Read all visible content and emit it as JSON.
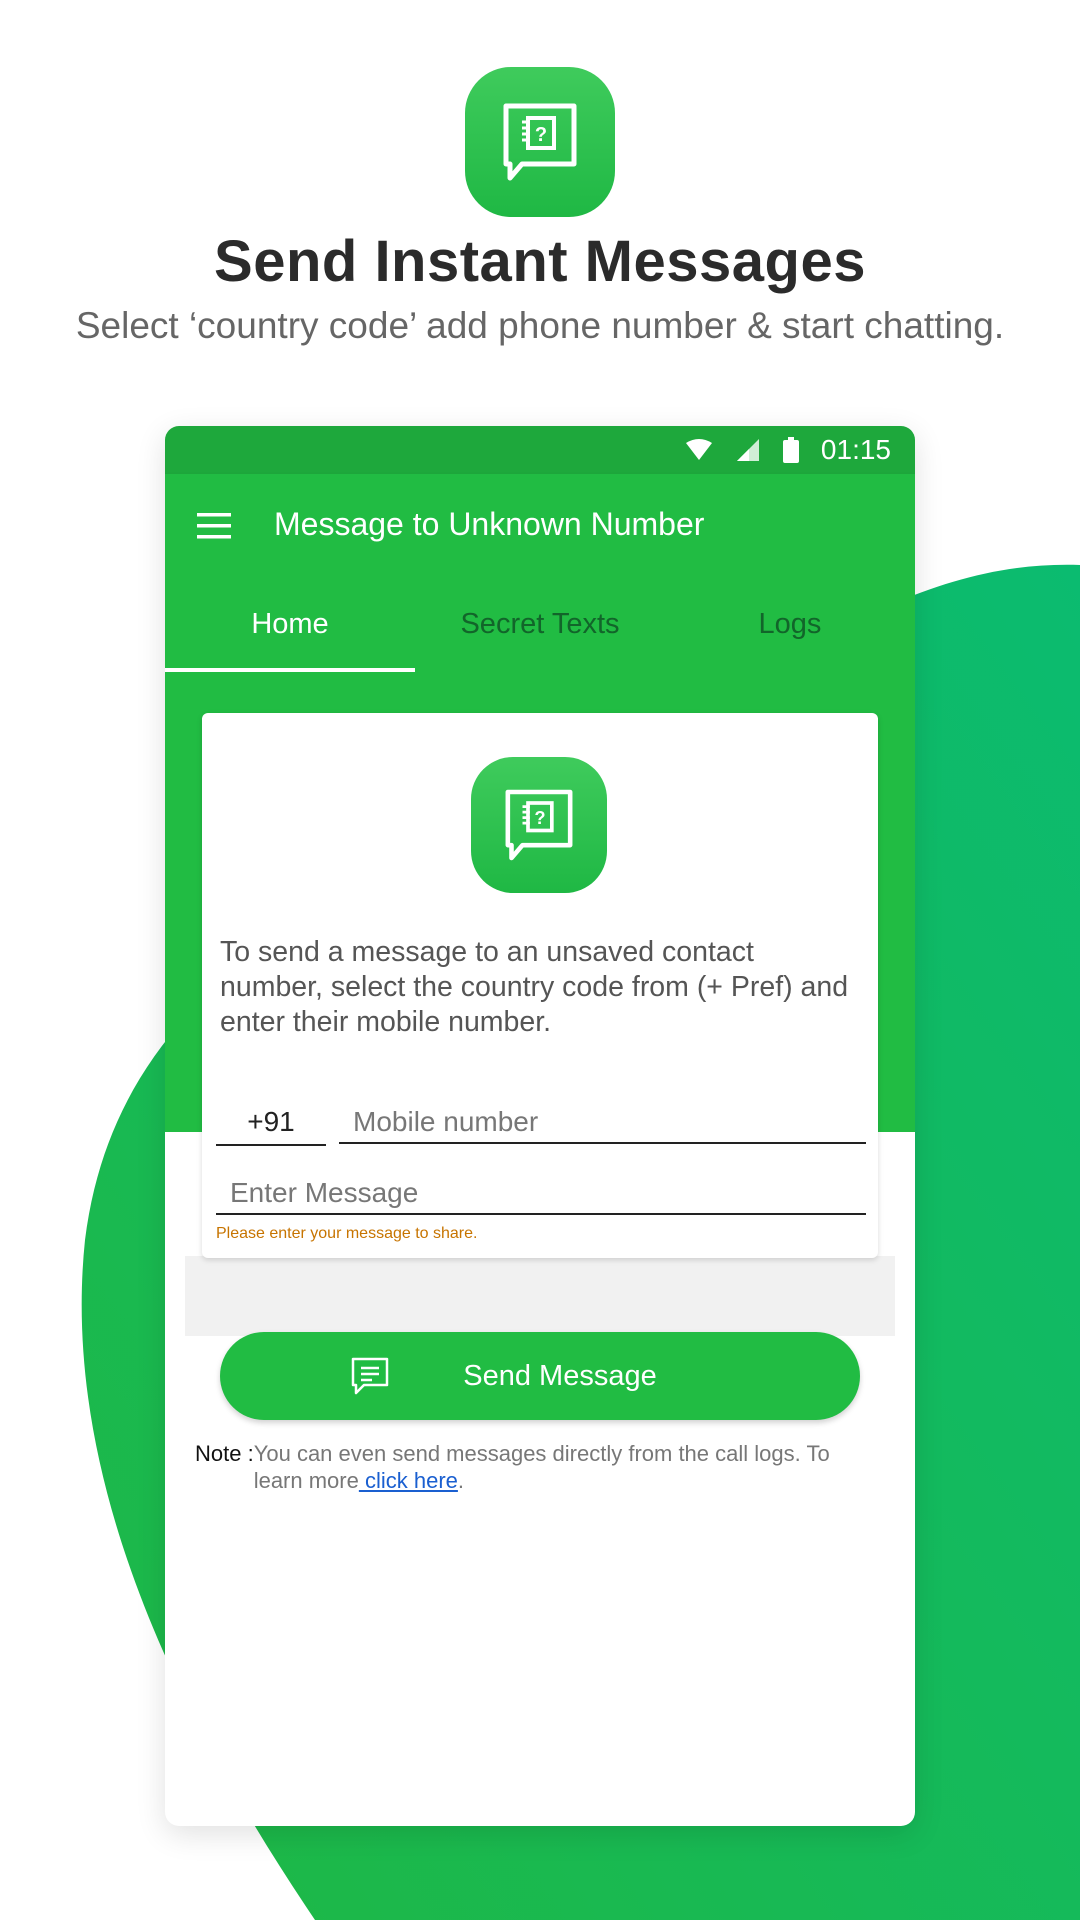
{
  "colors": {
    "brand_green": "#21bc43",
    "status_green": "#1ea83c",
    "link_blue": "#1a5fd0",
    "error_orange": "#c77400"
  },
  "promo": {
    "title": "Send Instant Messages",
    "subtitle": "Select ‘country code’ add phone number & start chatting.",
    "icon": "chat-question-icon"
  },
  "statusbar": {
    "time": "01:15",
    "icons": [
      "wifi-icon",
      "signal-icon",
      "battery-icon"
    ]
  },
  "toolbar": {
    "title": "Message to Unknown Number",
    "menu_icon": "hamburger-menu-icon"
  },
  "tabs": [
    {
      "label": "Home",
      "active": true
    },
    {
      "label": "Secret Texts",
      "active": false
    },
    {
      "label": "Logs",
      "active": false
    }
  ],
  "card": {
    "icon": "chat-question-icon",
    "description": "To send a message to an unsaved contact number, select the country code from (+ Pref) and enter their mobile number.",
    "country_code": "+91",
    "mobile_placeholder": "Mobile number",
    "message_placeholder": "Enter Message",
    "error": "Please enter your message to share."
  },
  "send_button": {
    "label": "Send Message",
    "icon": "message-icon"
  },
  "note": {
    "label": "Note :",
    "text": "You can even send messages directly from the call logs. To learn more",
    "link": " click here",
    "end": "."
  }
}
